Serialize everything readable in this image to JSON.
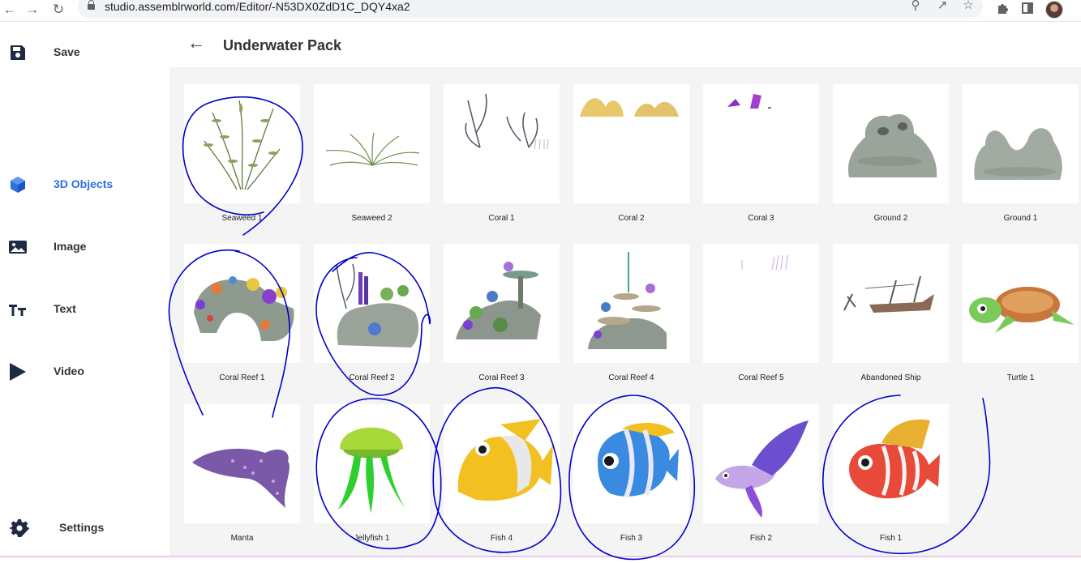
{
  "browser": {
    "url": "studio.assemblrworld.com/Editor/-N53DX0ZdD1C_DQY4xa2"
  },
  "sidebar": {
    "items": [
      {
        "label": "Save",
        "icon": "save-icon"
      },
      {
        "label": "3D Objects",
        "icon": "cube-icon",
        "active": true
      },
      {
        "label": "Image",
        "icon": "image-icon"
      },
      {
        "label": "Text",
        "icon": "text-icon"
      },
      {
        "label": "Video",
        "icon": "play-icon"
      },
      {
        "label": "Settings",
        "icon": "gear-icon"
      }
    ]
  },
  "header": {
    "title": "Underwater Pack"
  },
  "assets": [
    {
      "label": "Seaweed 1"
    },
    {
      "label": "Seaweed 2"
    },
    {
      "label": "Coral 1"
    },
    {
      "label": "Coral 2"
    },
    {
      "label": "Coral 3"
    },
    {
      "label": "Ground 2"
    },
    {
      "label": "Ground 1"
    },
    {
      "label": "Coral Reef 1"
    },
    {
      "label": "Coral Reef 2"
    },
    {
      "label": "Coral Reef 3"
    },
    {
      "label": "Coral Reef 4"
    },
    {
      "label": "Coral Reef 5"
    },
    {
      "label": "Abandoned Ship"
    },
    {
      "label": "Turtle 1"
    },
    {
      "label": "Manta"
    },
    {
      "label": "Jellyfish 1"
    },
    {
      "label": "Fish 4"
    },
    {
      "label": "Fish 3"
    },
    {
      "label": "Fish 2"
    },
    {
      "label": "Fish 1"
    }
  ],
  "colors": {
    "accent": "#2d6fe0",
    "annotation_ink": "#0000cc",
    "content_bg": "#f4f4f5"
  }
}
